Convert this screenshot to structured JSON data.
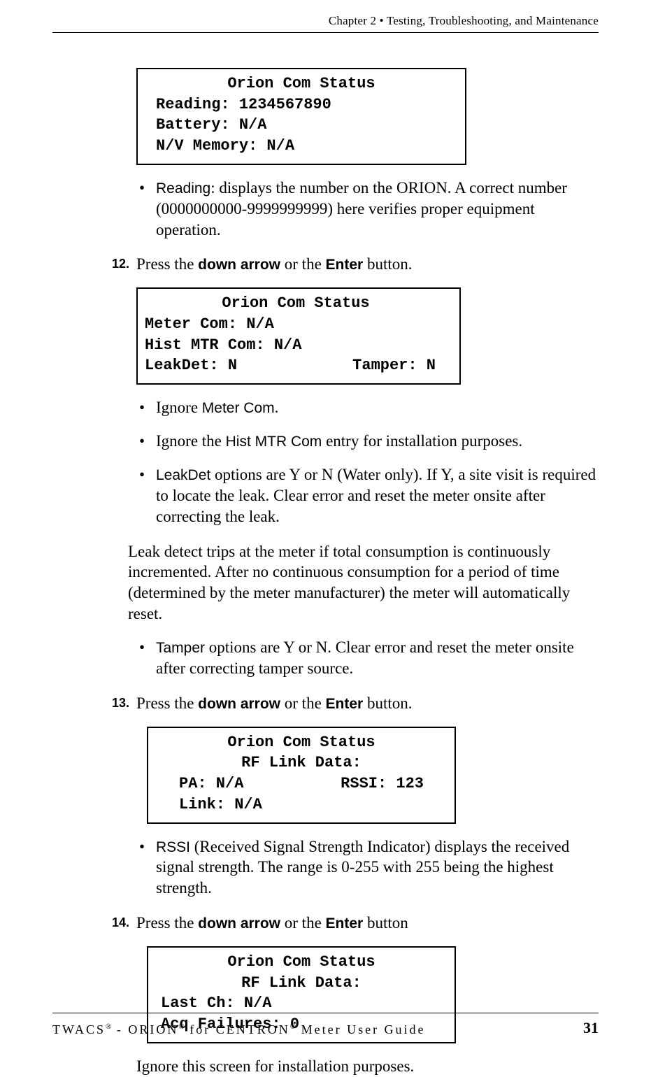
{
  "header": {
    "chapter": "Chapter 2 • Testing, Troubleshooting, and Maintenance"
  },
  "screen1": {
    "title": "Orion Com Status",
    "l1": "Reading: 1234567890",
    "l2": "Battery: N/A",
    "l3": "N/V Memory: N/A"
  },
  "bullet_reading": {
    "label": "Reading",
    "text": ": displays the number on the ORION. A correct number (0000000000-9999999999) here verifies proper equipment operation."
  },
  "step12": {
    "num": "12.",
    "t1": "Press the ",
    "k1": "down arrow",
    "t2": " or the ",
    "k2": "Enter",
    "t3": " button."
  },
  "screen2": {
    "title": "Orion Com Status",
    "l1": "Meter Com: N/A",
    "l2": "Hist MTR Com: N/A",
    "l3a": "LeakDet: N",
    "l3b": "Tamper: N"
  },
  "bullets2": {
    "b1a": "Ignore ",
    "b1b": "Meter Com",
    "b1c": ".",
    "b2a": "Ignore the ",
    "b2b": "Hist MTR Com",
    "b2c": " entry for installation purposes.",
    "b3label": "LeakDet",
    "b3text": " options are Y or N (Water only). If Y, a site visit is required to locate the leak. Clear error and reset the meter onsite after correcting the leak."
  },
  "leak_note": "Leak detect trips at the meter if total consumption is continuously incremented. After no continuous consumption for a period of time (determined by the meter manufacturer) the meter will automatically reset.",
  "bullet_tamper": {
    "label": "Tamper",
    "text": " options are Y or N. Clear error and reset the meter onsite after correcting tamper source."
  },
  "step13": {
    "num": "13.",
    "t1": "Press the ",
    "k1": "down arrow",
    "t2": " or the ",
    "k2": "Enter",
    "t3": " button."
  },
  "screen3": {
    "title": "Orion Com Status",
    "sub": "RF Link Data:",
    "l1a": "PA: N/A",
    "l1b": "RSSI: 123",
    "l2": "Link: N/A"
  },
  "bullet_rssi": {
    "label": "RSSI",
    "text": " (Received Signal Strength Indicator) displays the received signal strength. The range is 0-255 with 255 being the highest strength."
  },
  "step14": {
    "num": "14.",
    "t1": "Press the ",
    "k1": "down arrow",
    "t2": " or the ",
    "k2": "Enter",
    "t3": " button"
  },
  "screen4": {
    "title": "Orion Com Status",
    "sub": "RF Link Data:",
    "l1": "Last Ch: N/A",
    "l2": "Acq Failures: 0"
  },
  "ignore_note": "Ignore this screen for installation purposes.",
  "footer": {
    "left": "TWACS® - ORION® for CENTRON® Meter User Guide",
    "page": "31"
  }
}
